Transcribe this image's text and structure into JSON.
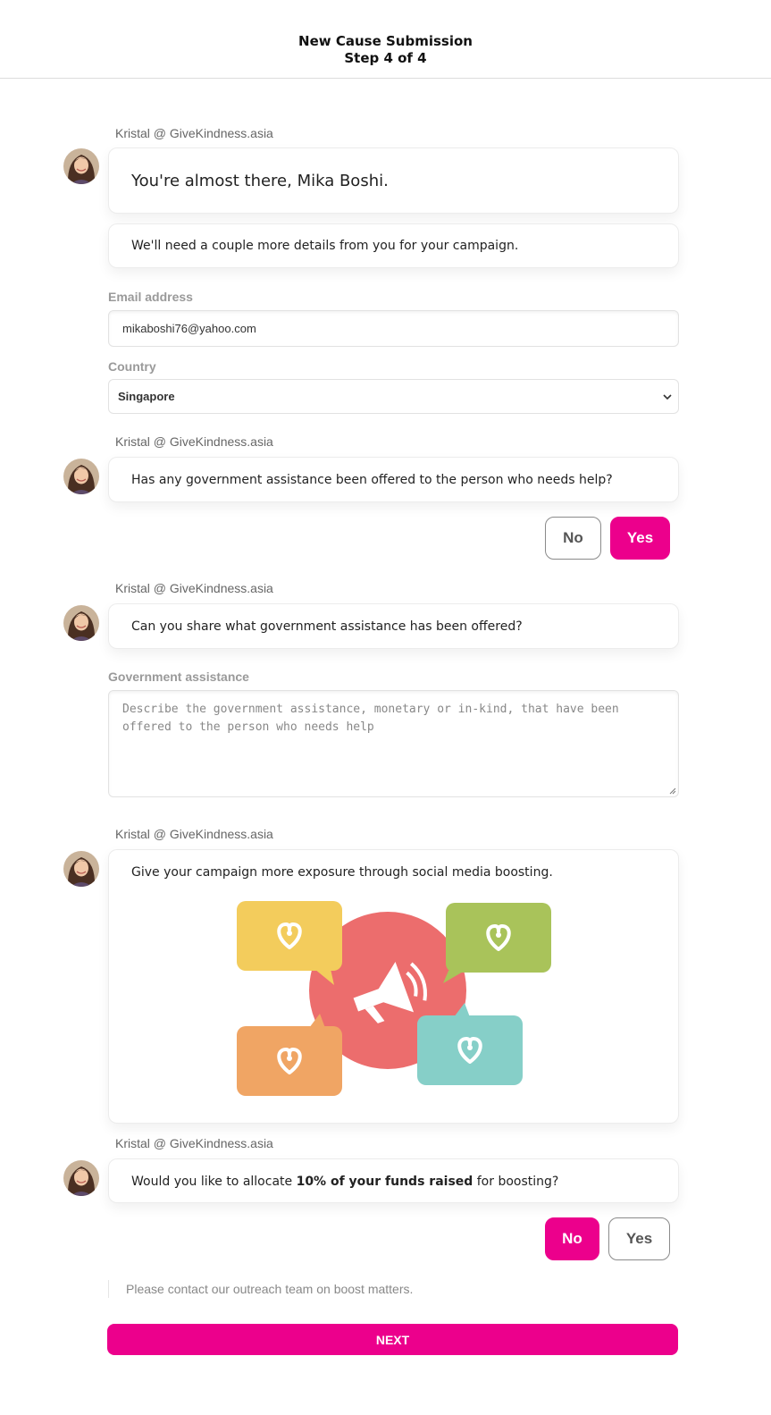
{
  "header": {
    "title": "New Cause Submission",
    "step": "Step 4 of 4"
  },
  "sender_name": "Kristal @ GiveKindness.asia",
  "messages": {
    "greeting": "You're almost there, Mika Boshi.",
    "details": "We'll need a couple more details from you for your campaign.",
    "gov_question": "Has any government assistance been offered to the person who needs help?",
    "gov_share": "Can you share what government assistance has been offered?",
    "exposure": "Give your campaign more exposure through social media boosting.",
    "allocate_prefix": "Would you like to allocate ",
    "allocate_bold": "10% of your funds raised",
    "allocate_suffix": " for boosting?"
  },
  "form": {
    "email_label": "Email address",
    "email_value": "mikaboshi76@yahoo.com",
    "country_label": "Country",
    "country_value": "Singapore",
    "gov_label": "Government assistance",
    "gov_placeholder": "Describe the government assistance, monetary or in-kind, that have been offered to the person who needs help"
  },
  "buttons": {
    "no": "No",
    "yes": "Yes",
    "next": "NEXT"
  },
  "choices": {
    "gov_assistance": "Yes",
    "boost_allocation": "No"
  },
  "note": "Please contact our outreach team on boost matters.",
  "colors": {
    "accent": "#ec008c",
    "bubble_yellow": "#f3cc5c",
    "bubble_green": "#a9c35a",
    "bubble_orange": "#f0a564",
    "bubble_teal": "#86cfc8",
    "megaphone_circle": "#ec6d6d"
  },
  "icons": [
    "avatar",
    "chevron-down-icon",
    "megaphone-icon",
    "heart-icon",
    "resize-grip-icon"
  ]
}
